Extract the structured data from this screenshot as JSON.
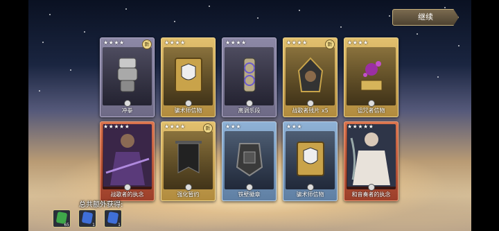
{
  "continue_label": "继续",
  "cards_row1": [
    {
      "name": "冲拳",
      "stars": "★★★★",
      "new": "新",
      "frame": "purple",
      "icon": "gauntlet-icon"
    },
    {
      "name": "骗术师信物",
      "stars": "★★★★",
      "new": "",
      "frame": "gold",
      "icon": "shield-book-icon"
    },
    {
      "name": "离调乐段",
      "stars": "★★★★",
      "new": "",
      "frame": "purple",
      "icon": "scroll-icon"
    },
    {
      "name": "战歌者残片 x5",
      "stars": "★★★★",
      "new": "新",
      "frame": "gold",
      "icon": "hooded-figure-icon"
    },
    {
      "name": "诅咒者信物",
      "stars": "★★★★",
      "new": "",
      "frame": "gold",
      "icon": "potion-altar-icon"
    }
  ],
  "cards_row2": [
    {
      "name": "战歌者的执念",
      "stars": "★★★★★",
      "new": "",
      "frame": "red",
      "icon": "warrior-portrait-icon"
    },
    {
      "name": "强化暂约",
      "stars": "★★★★",
      "new": "新",
      "frame": "gold",
      "icon": "banner-icon"
    },
    {
      "name": "铁壁徽章",
      "stars": "★★★",
      "new": "",
      "frame": "blue",
      "icon": "shield-badge-icon"
    },
    {
      "name": "骗术师信物",
      "stars": "★★★",
      "new": "",
      "frame": "blue",
      "icon": "shield-book-icon"
    },
    {
      "name": "和音奏者的执念",
      "stars": "★★★★★",
      "new": "",
      "frame": "red",
      "icon": "musician-portrait-icon"
    }
  ],
  "bonus_label": "总共额外获得:",
  "bonus_items": [
    {
      "icon": "green-crystal-icon",
      "count": "65"
    },
    {
      "icon": "blue-rune-icon",
      "count": "1"
    },
    {
      "icon": "blue-rune-icon",
      "count": "1"
    }
  ]
}
